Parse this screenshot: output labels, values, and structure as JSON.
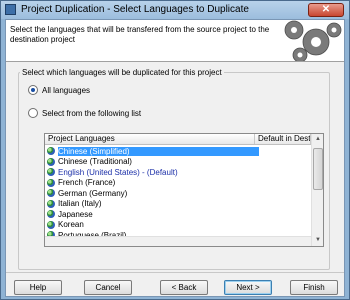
{
  "window": {
    "title": "Project Duplication - Select Languages to Duplicate",
    "close_label": "✕"
  },
  "banner": {
    "text": "Select the languages that will be transfered from the source project to the destination project",
    "icon": "gears-icon"
  },
  "group": {
    "label": "Select which languages will be duplicated for this project"
  },
  "options": {
    "all_languages": {
      "label": "All languages",
      "selected": true
    },
    "from_list": {
      "label": "Select from the following list",
      "selected": false
    }
  },
  "listview": {
    "columns": [
      "Project Languages",
      "Default in Destina"
    ],
    "rows": [
      {
        "name": "Chinese (Simplified)",
        "selected": true,
        "default": false
      },
      {
        "name": "Chinese (Traditional)",
        "selected": false,
        "default": false
      },
      {
        "name": "English (United States) - (Default)",
        "selected": false,
        "default": true
      },
      {
        "name": "French (France)",
        "selected": false,
        "default": false
      },
      {
        "name": "German (Germany)",
        "selected": false,
        "default": false
      },
      {
        "name": "Italian (Italy)",
        "selected": false,
        "default": false
      },
      {
        "name": "Japanese",
        "selected": false,
        "default": false
      },
      {
        "name": "Korean",
        "selected": false,
        "default": false
      },
      {
        "name": "Portuguese (Brazil)",
        "selected": false,
        "default": false
      }
    ],
    "row_icon": "globe-icon"
  },
  "buttons": {
    "help": "Help",
    "cancel": "Cancel",
    "back": "< Back",
    "next": "Next >",
    "finish": "Finish"
  },
  "colors": {
    "selection": "#3399ff",
    "default_text": "#1b2fa8",
    "titlebar": "#9cbddd"
  }
}
